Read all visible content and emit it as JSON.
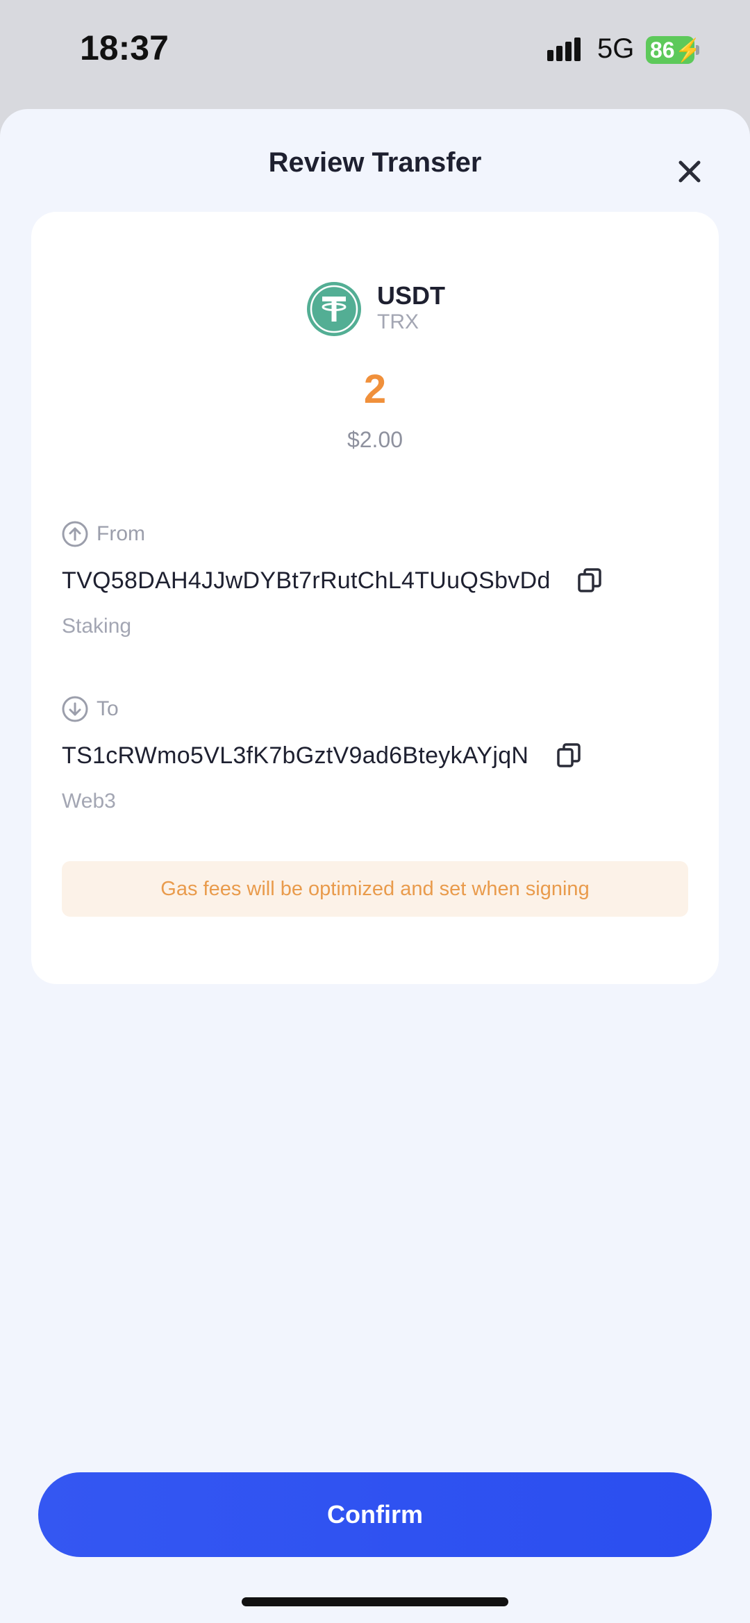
{
  "status_bar": {
    "time": "18:37",
    "network": "5G",
    "battery": "86"
  },
  "sheet": {
    "title": "Review Transfer"
  },
  "token": {
    "name": "USDT",
    "network": "TRX",
    "amount": "2",
    "fiat_value": "$2.00",
    "brand_color": "#53ae94"
  },
  "from": {
    "label": "From",
    "address": "TVQ58DAH4JJwDYBt7rRutChL4TUuQSbvDd",
    "account_name": "Staking"
  },
  "to": {
    "label": "To",
    "address": "TS1cRWmo5VL3fK7bGztV9ad6BteykAYjqN",
    "account_name": "Web3"
  },
  "notice": {
    "text": "Gas fees will be optimized and set when signing"
  },
  "actions": {
    "confirm_label": "Confirm"
  },
  "colors": {
    "accent": "#2f52f1",
    "amount": "#f0903b",
    "notice_bg": "#fcf2e8",
    "notice_text": "#e99b4c"
  }
}
